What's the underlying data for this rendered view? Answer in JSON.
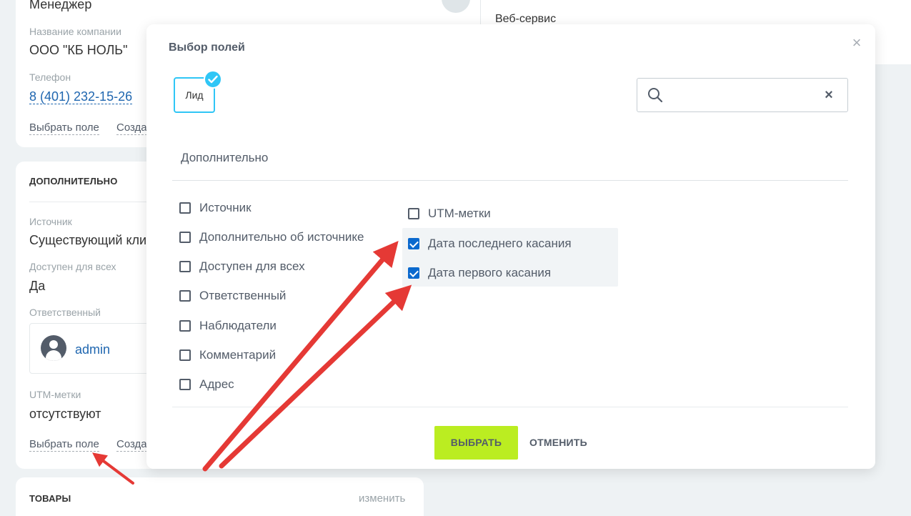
{
  "background": {
    "position_value": "Менеджер",
    "company_label": "Название компании",
    "company_value": "ООО \"КБ НОЛЬ\"",
    "phone_label": "Телефон",
    "phone_value": "8 (401) 232-15-26",
    "choose_field_link": "Выбрать поле",
    "create_field_link": "Созда",
    "extra_section_title": "ДОПОЛНИТЕЛЬНО",
    "source_label": "Источник",
    "source_value": "Существующий кли",
    "available_label": "Доступен для всех",
    "available_value": "Да",
    "responsible_label": "Ответственный",
    "responsible_user": "admin",
    "utm_label": "UTM-метки",
    "utm_value": "отсутствуют",
    "products_title": "ТОВАРЫ",
    "products_change": "изменить",
    "timeline_text": "Веб-сервис"
  },
  "modal": {
    "title": "Выбор полей",
    "entity_label": "Лид",
    "search_placeholder": "",
    "search_value": "",
    "section_title": "Дополнительно",
    "left_options": [
      {
        "label": "Источник",
        "checked": false
      },
      {
        "label": "Дополнительно об источнике",
        "checked": false
      },
      {
        "label": "Доступен для всех",
        "checked": false
      },
      {
        "label": "Ответственный",
        "checked": false
      },
      {
        "label": "Наблюдатели",
        "checked": false
      },
      {
        "label": "Комментарий",
        "checked": false
      },
      {
        "label": "Адрес",
        "checked": false
      }
    ],
    "right_options": [
      {
        "label": "UTM-метки",
        "checked": false
      },
      {
        "label": "Дата последнего касания",
        "checked": true
      },
      {
        "label": "Дата первого касания",
        "checked": true
      }
    ],
    "select_button": "ВЫБРАТЬ",
    "cancel_button": "ОТМЕНИТЬ"
  },
  "colors": {
    "accent_blue": "#2fc6f6",
    "checkbox_blue": "#0b69ce",
    "select_green": "#bbed21",
    "arrow_red": "#e53935"
  }
}
